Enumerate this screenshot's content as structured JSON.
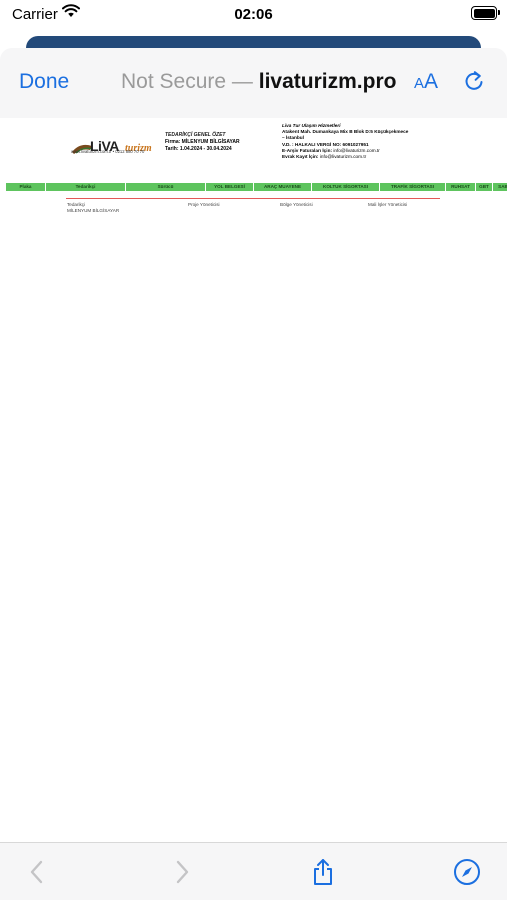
{
  "status_bar": {
    "carrier": "Carrier",
    "time": "02:06"
  },
  "nav": {
    "done_label": "Done",
    "security": "Not Secure",
    "separator": "—",
    "host": "livaturizm.pro",
    "aa_small": "A",
    "aa_large": "A"
  },
  "document": {
    "logo_text": "LiVA turizm",
    "logo_sub": "www.livaturizm.com.tr • 0212 880 70 70",
    "summary": {
      "title": "TEDARİKÇİ GENEL ÖZET",
      "firm_label": "Firma:",
      "firm": "MİLENYUM BİLGİSAYAR",
      "date_label": "Tarih:",
      "date_range": "1.04.2024 - 30.04.2024"
    },
    "company": {
      "name": "Liva Tur Ulaşım Hizmetleri",
      "address_1": "Atakent Mah. Dumankaya Mix B Blok D:5 Küçükçekmece",
      "address_2": "– İstanbul",
      "tax": "V.D. : HALKALI VERGİ NO: 6091027951",
      "einvoice_label": "E-Arşiv Faturaları İçin:",
      "einvoice_mail": "info@livaturizm.com.tr",
      "record_label": "Evrak Kayıt İçin:",
      "record_mail": "info@livaturizm.com.tr"
    },
    "table_headers": [
      "Plaka",
      "Tedarikçi",
      "Sürücü",
      "YOL BELGESİ",
      "ARAÇ MUAYENE",
      "KOLTUK SİGORTASI",
      "TRAFİK SİGORTASI",
      "RUHSAT",
      "GBT",
      "SAB"
    ],
    "signatures": {
      "supplier_label": "Tedarikçi",
      "supplier_name": "MİLENYUM BİLGİSAYAR",
      "project_manager": "Proje Yöneticisi",
      "region_manager": "Bölge Yöneticisi",
      "finance_manager": "Mali İşler Yöneticisi"
    }
  },
  "colors": {
    "accent": "#1b6fe0",
    "header_green": "#5ec45e",
    "red_line": "#e45757",
    "sheet_back": "#234a7a"
  },
  "icons": {
    "wifi": "wifi-icon",
    "battery": "battery-icon",
    "reload": "reload-icon",
    "back": "chevron-left-icon",
    "forward": "chevron-right-icon",
    "share": "share-icon",
    "safari": "compass-icon"
  }
}
